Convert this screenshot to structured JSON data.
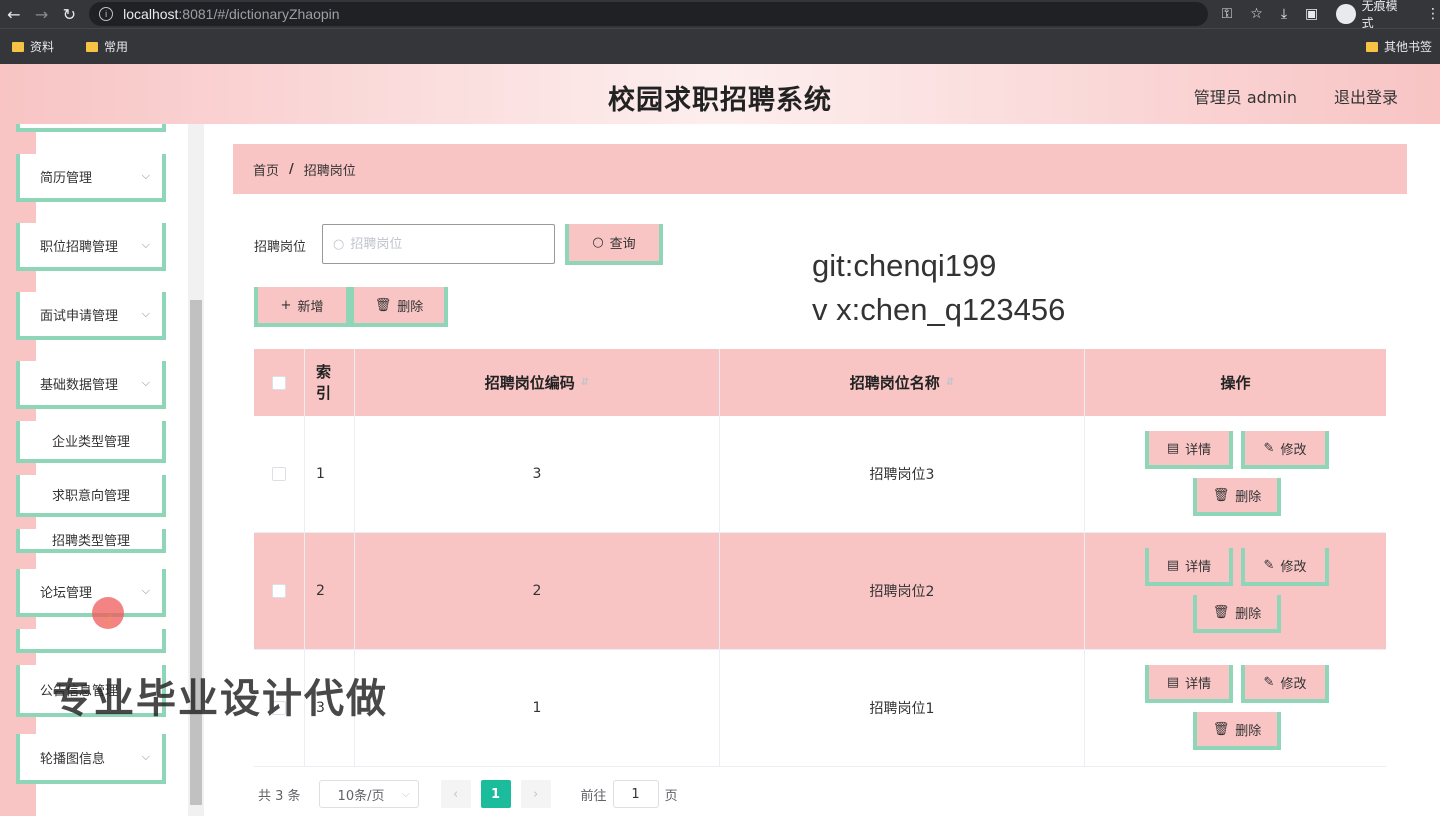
{
  "browser": {
    "url_host": "localhost",
    "url_rest": ":8081/#/dictionaryZhaopin",
    "incognito_label": "无痕模式",
    "bookmarks": [
      "资料",
      "常用"
    ],
    "other_bookmarks": "其他书签"
  },
  "header": {
    "title": "校园求职招聘系统",
    "user": "管理员 admin",
    "logout": "退出登录"
  },
  "sidebar": {
    "items": [
      {
        "label": "简历管理"
      },
      {
        "label": "职位招聘管理"
      },
      {
        "label": "面试申请管理"
      },
      {
        "label": "基础数据管理"
      },
      {
        "label": "论坛管理"
      },
      {
        "label": "公告信息管理"
      },
      {
        "label": "轮播图信息"
      }
    ],
    "sub_items": [
      {
        "label": "企业类型管理"
      },
      {
        "label": "求职意向管理"
      },
      {
        "label": "招聘类型管理"
      }
    ]
  },
  "breadcrumb": {
    "home": "首页",
    "separator": "/",
    "current": "招聘岗位"
  },
  "search": {
    "label": "招聘岗位",
    "placeholder": "招聘岗位",
    "query_button": "查询"
  },
  "actions": {
    "add": "新增",
    "delete": "删除"
  },
  "watermark": {
    "line1": "git:chenqi199",
    "line2": "v x:chen_q123456",
    "overlay": "专业毕业设计代做"
  },
  "table": {
    "headers": {
      "index": "索引",
      "code": "招聘岗位编码",
      "name": "招聘岗位名称",
      "ops": "操作"
    },
    "rows": [
      {
        "index": "1",
        "code": "3",
        "name": "招聘岗位3"
      },
      {
        "index": "2",
        "code": "2",
        "name": "招聘岗位2"
      },
      {
        "index": "3",
        "code": "1",
        "name": "招聘岗位1"
      }
    ],
    "op_labels": {
      "detail": "详情",
      "edit": "修改",
      "delete": "删除"
    }
  },
  "pagination": {
    "total": "共 3 条",
    "page_size": "10条/页",
    "current_page": "1",
    "goto_label": "前往",
    "goto_value": "1",
    "page_suffix": "页"
  },
  "colors": {
    "pink": "#f8c4c4",
    "mint": "#8fd6b8",
    "active_page": "#1bbc9b"
  }
}
